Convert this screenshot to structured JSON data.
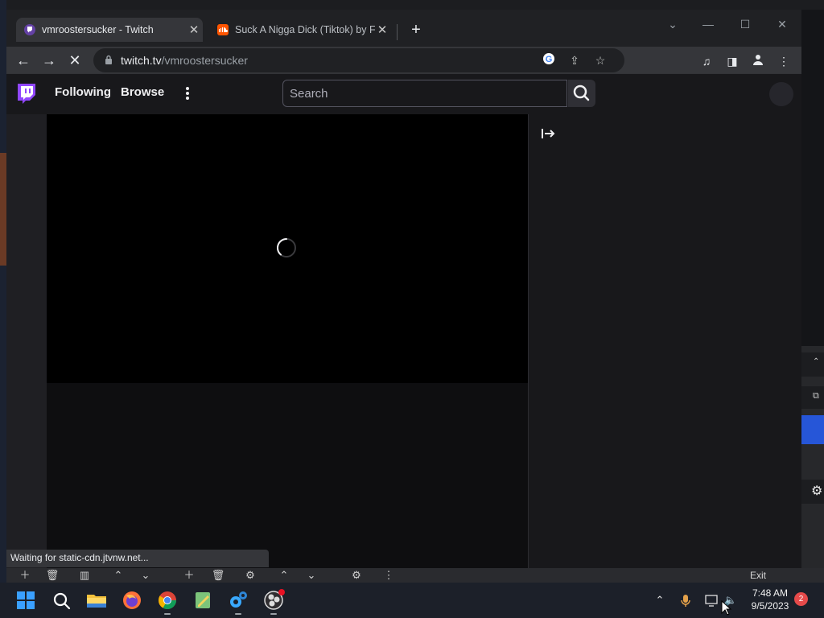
{
  "browser": {
    "tabs": [
      {
        "title": "vmroostersucker - Twitch",
        "favicon": "twitch-favicon",
        "active": true
      },
      {
        "title": "Suck A Nigga Dick (Tiktok) by Fri",
        "favicon": "soundcloud-favicon",
        "active": false
      }
    ],
    "new_tab_glyph": "+",
    "url": {
      "host": "twitch.tv",
      "path": "/vmroostersucker"
    },
    "status": "Waiting for static-cdn.jtvnw.net..."
  },
  "twitch": {
    "nav": {
      "following": "Following",
      "browse": "Browse"
    },
    "search": {
      "placeholder": "Search"
    }
  },
  "background_app": {
    "exit_label": "Exit"
  },
  "taskbar": {
    "time": "7:48 AM",
    "date": "9/5/2023",
    "notifications": "2"
  },
  "colors": {
    "twitch_purple": "#9147ff",
    "page_bg": "#0e0e10",
    "chrome_toolbar": "#35363a",
    "taskbar_bg": "#1c2029",
    "accent_blue": "#2656d8"
  }
}
